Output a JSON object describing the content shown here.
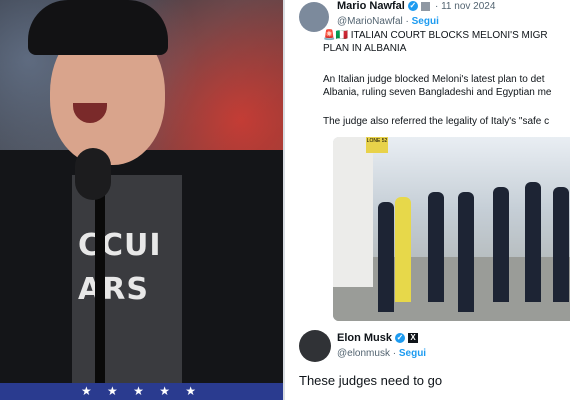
{
  "left_photo": {
    "shirt_line1": "CCUI",
    "shirt_line2": "ARS",
    "stars": "★ ★ ★ ★ ★"
  },
  "post1": {
    "name": "Mario Nawfal",
    "handle": "@MarioNawfal",
    "follow": "Segui",
    "date": "· 11 nov 2024",
    "flags": "🚨🇮🇹",
    "headline": "ITALIAN COURT BLOCKS MELONI'S MIGR",
    "headline2": "PLAN IN ALBANIA",
    "para1_line1": "An Italian judge blocked Meloni's latest plan to det",
    "para1_line2": "Albania, ruling seven Bangladeshi and Egyptian me",
    "para2": "The judge also referred the legality of Italy's \"safe c",
    "photo_sign": "LONE 52"
  },
  "post2": {
    "name": "Elon Musk",
    "handle": "@elonmusk",
    "follow": "Segui",
    "text": "These judges need to go"
  }
}
